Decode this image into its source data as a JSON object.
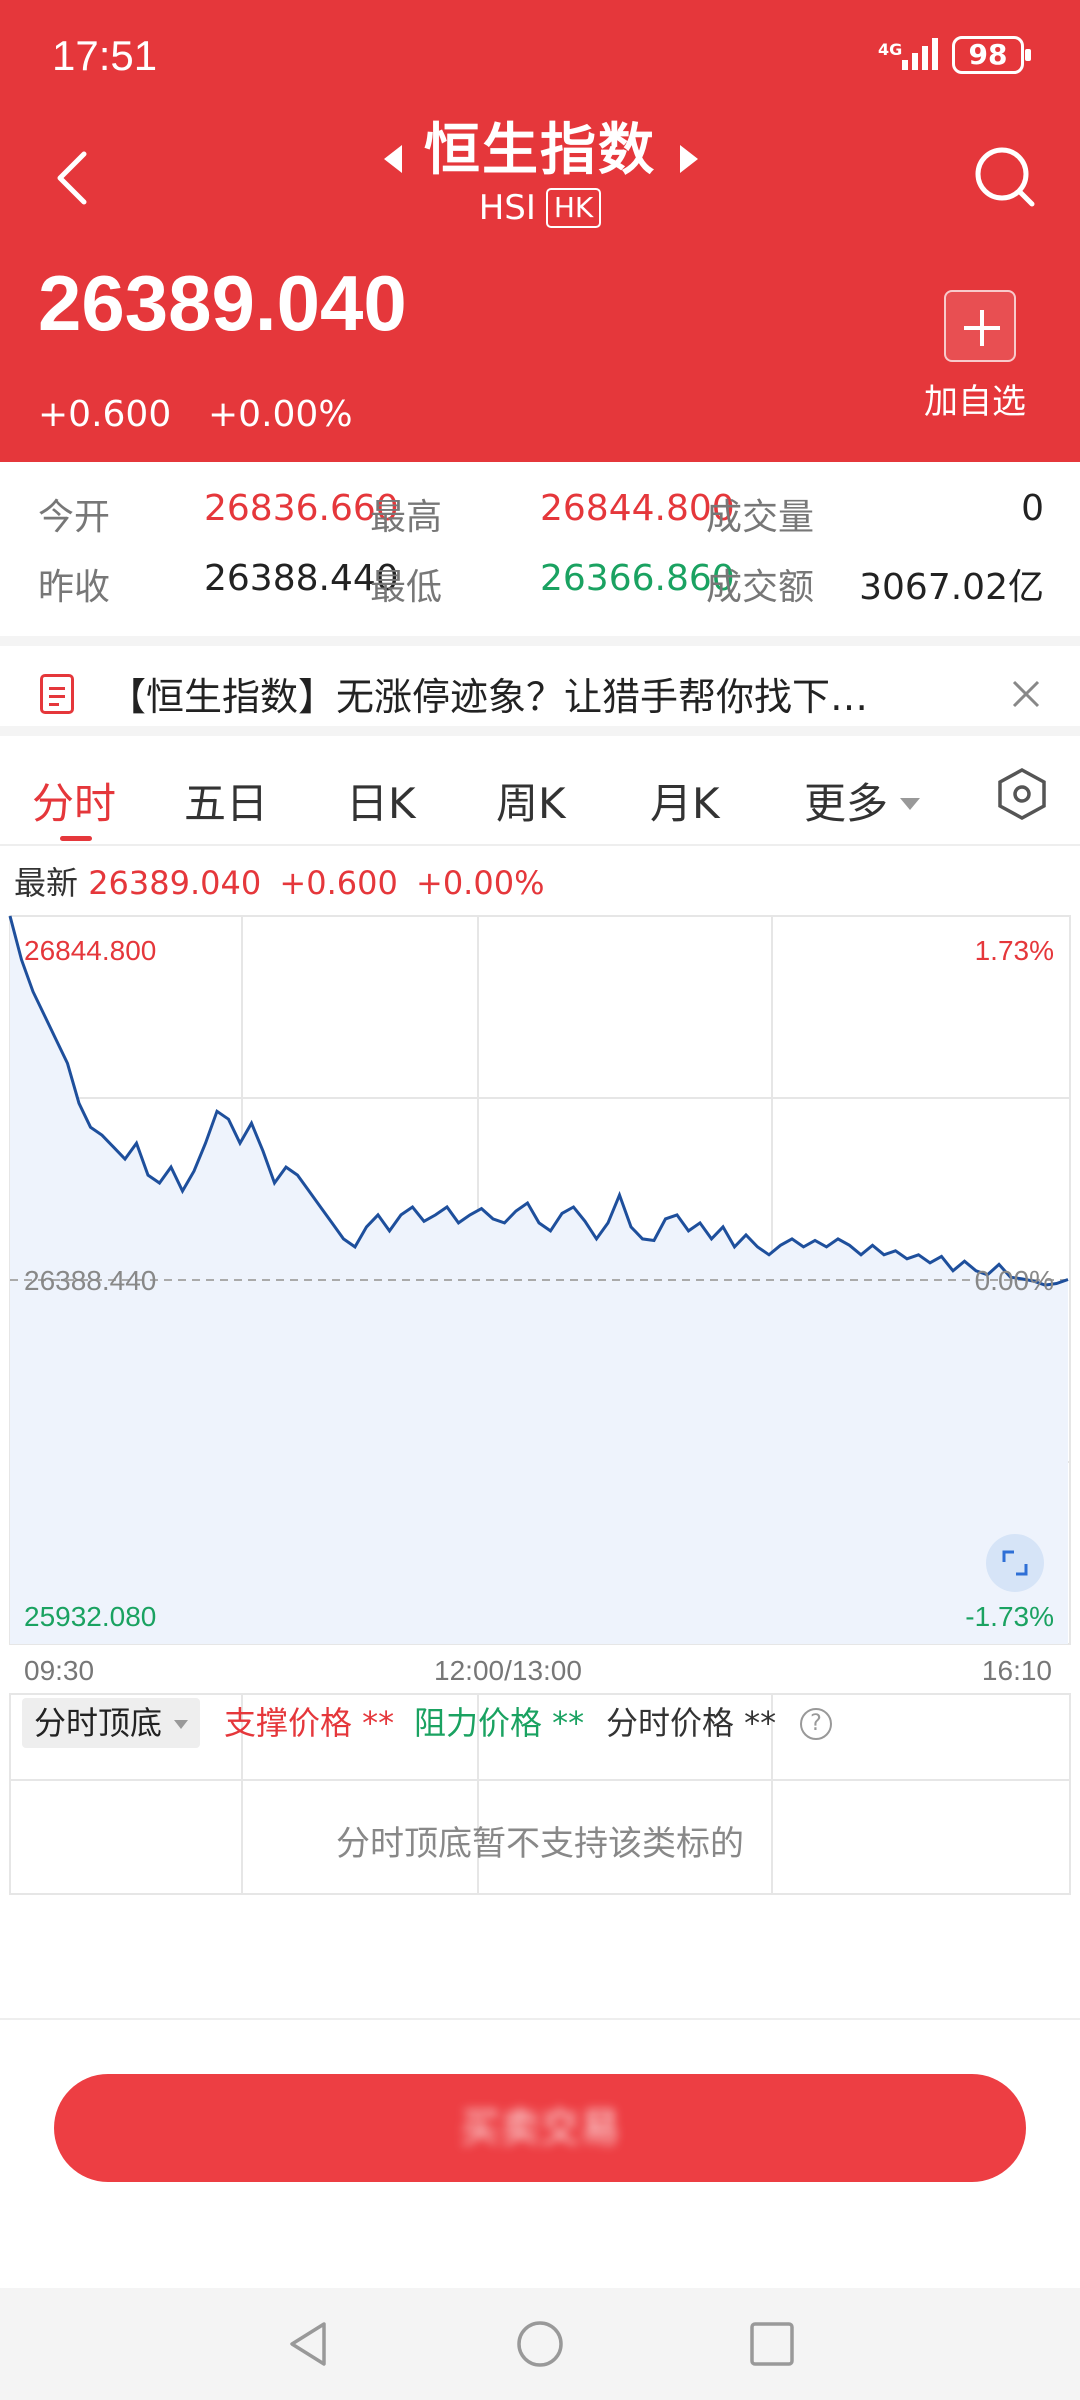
{
  "status_bar": {
    "time": "17:51",
    "network": "4G",
    "battery": "98"
  },
  "header": {
    "title": "恒生指数",
    "code": "HSI",
    "market": "HK",
    "price": "26389.040",
    "change": "+0.600",
    "change_pct": "+0.00%",
    "add_watchlist": "加自选",
    "bg_color": "#e5373b"
  },
  "stats": {
    "open_label": "今开",
    "open": "26836.660",
    "high_label": "最高",
    "high": "26844.800",
    "volume_label": "成交量",
    "volume": "0",
    "prev_close_label": "昨收",
    "prev_close": "26388.440",
    "low_label": "最低",
    "low": "26366.860",
    "turnover_label": "成交额",
    "turnover": "3067.02亿"
  },
  "news": {
    "text": "【恒生指数】无涨停迹象？让猎手帮你找下…"
  },
  "tabs": [
    {
      "label": "分时",
      "active": true
    },
    {
      "label": "五日"
    },
    {
      "label": "日K"
    },
    {
      "label": "周K"
    },
    {
      "label": "月K"
    },
    {
      "label": "更多"
    }
  ],
  "latest": {
    "label": "最新",
    "price": "26389.040",
    "change": "+0.600",
    "change_pct": "+0.00%"
  },
  "chart_data": {
    "type": "line",
    "y_max": "26844.800",
    "y_max_pct": "1.73%",
    "y_base": "26388.440",
    "y_base_pct": "0.00%",
    "y_min": "25932.080",
    "y_min_pct": "-1.73%",
    "ylim": [
      25932.08,
      26844.8
    ],
    "x_labels": [
      "09:30",
      "12:00/13:00",
      "16:10"
    ],
    "grid": true,
    "series": [
      {
        "values": [
          26844.8,
          26790,
          26750,
          26720,
          26690,
          26660,
          26610,
          26580,
          26570,
          26555,
          26540,
          26560,
          26520,
          26510,
          26530,
          26500,
          26525,
          26560,
          26600,
          26590,
          26560,
          26585,
          26550,
          26510,
          26530,
          26520,
          26500,
          26480,
          26460,
          26440,
          26430,
          26455,
          26470,
          26450,
          26470,
          26480,
          26462,
          26470,
          26480,
          26460,
          26470,
          26478,
          26465,
          26460,
          26475,
          26485,
          26460,
          26450,
          26472,
          26480,
          26462,
          26440,
          26460,
          26495,
          26455,
          26440,
          26438,
          26465,
          26470,
          26450,
          26460,
          26440,
          26455,
          26430,
          26445,
          26430,
          26420,
          26432,
          26440,
          26430,
          26438,
          26430,
          26440,
          26432,
          26420,
          26432,
          26420,
          26425,
          26415,
          26420,
          26410,
          26418,
          26400,
          26412,
          26400,
          26395,
          26408,
          26392,
          26390,
          26387,
          26382,
          26384,
          26389.04
        ]
      }
    ]
  },
  "indicator": {
    "select_label": "分时顶底",
    "support_label": "支撑价格 **",
    "resistance_label": "阻力价格 **",
    "price_label": "分时价格 **",
    "help": "?",
    "empty_msg": "分时顶底暂不支持该类标的"
  },
  "action_button": {
    "label": "买卖交易"
  },
  "colors": {
    "up": "#e5373b",
    "down": "#1aa261",
    "line": "#1e4f9c",
    "fill": "#eef3fc"
  }
}
